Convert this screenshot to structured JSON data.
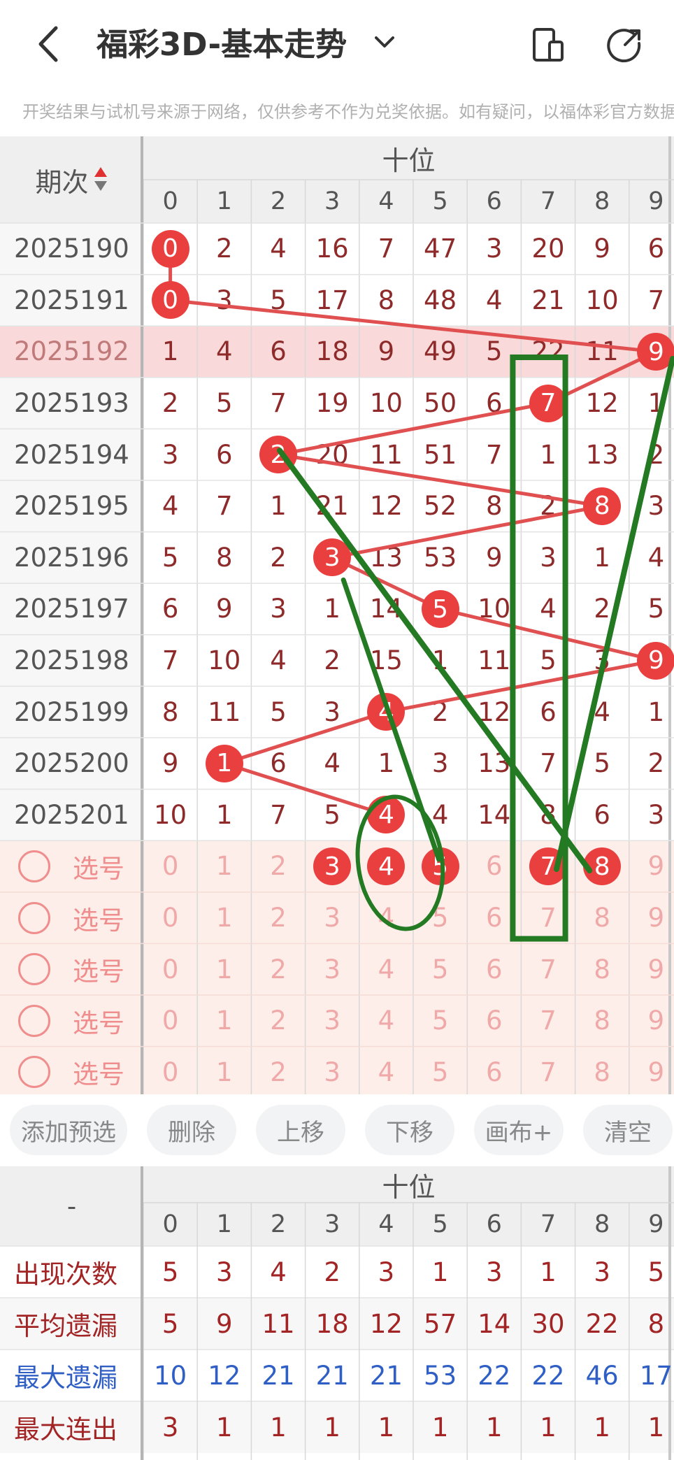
{
  "header": {
    "title": "福彩3D-基本走势",
    "notice": "开奖结果与试机号来源于网络，仅供参考不作为兑奖依据。如有疑问，以福体彩官方数据"
  },
  "table": {
    "period_header": "期次",
    "group_header": "十位",
    "digits": [
      "0",
      "1",
      "2",
      "3",
      "4",
      "5",
      "6",
      "7",
      "8",
      "9"
    ],
    "rows": [
      {
        "period": "2025190",
        "cells": [
          "0",
          "2",
          "4",
          "16",
          "7",
          "47",
          "3",
          "20",
          "9",
          "6"
        ],
        "hit": 0
      },
      {
        "period": "2025191",
        "cells": [
          "0",
          "3",
          "5",
          "17",
          "8",
          "48",
          "4",
          "21",
          "10",
          "7"
        ],
        "hit": 0
      },
      {
        "period": "2025192",
        "cells": [
          "1",
          "4",
          "6",
          "18",
          "9",
          "49",
          "5",
          "22",
          "11",
          "9"
        ],
        "hit": 9
      },
      {
        "period": "2025193",
        "cells": [
          "2",
          "5",
          "7",
          "19",
          "10",
          "50",
          "6",
          "7",
          "12",
          "1"
        ],
        "hit": 7
      },
      {
        "period": "2025194",
        "cells": [
          "3",
          "6",
          "2",
          "20",
          "11",
          "51",
          "7",
          "1",
          "13",
          "2"
        ],
        "hit": 2
      },
      {
        "period": "2025195",
        "cells": [
          "4",
          "7",
          "1",
          "21",
          "12",
          "52",
          "8",
          "2",
          "8",
          "3"
        ],
        "hit": 8
      },
      {
        "period": "2025196",
        "cells": [
          "5",
          "8",
          "2",
          "3",
          "13",
          "53",
          "9",
          "3",
          "1",
          "4"
        ],
        "hit": 3
      },
      {
        "period": "2025197",
        "cells": [
          "6",
          "9",
          "3",
          "1",
          "14",
          "5",
          "10",
          "4",
          "2",
          "5"
        ],
        "hit": 5
      },
      {
        "period": "2025198",
        "cells": [
          "7",
          "10",
          "4",
          "2",
          "15",
          "1",
          "11",
          "5",
          "3",
          "9"
        ],
        "hit": 9
      },
      {
        "period": "2025199",
        "cells": [
          "8",
          "11",
          "5",
          "3",
          "4",
          "2",
          "12",
          "6",
          "4",
          "1"
        ],
        "hit": 4
      },
      {
        "period": "2025200",
        "cells": [
          "9",
          "1",
          "6",
          "4",
          "1",
          "3",
          "13",
          "7",
          "5",
          "2"
        ],
        "hit": 1
      },
      {
        "period": "2025201",
        "cells": [
          "10",
          "1",
          "7",
          "5",
          "4",
          "4",
          "14",
          "8",
          "6",
          "3"
        ],
        "hit": 4
      }
    ],
    "pick_label": "选号",
    "pick_rows": [
      {
        "selected": [
          3,
          4,
          5,
          7,
          8
        ]
      },
      {
        "selected": []
      },
      {
        "selected": []
      },
      {
        "selected": []
      },
      {
        "selected": []
      }
    ]
  },
  "toolbar": {
    "buttons": [
      "添加预选",
      "删除",
      "上移",
      "下移",
      "画布+",
      "清空"
    ]
  },
  "stats": {
    "corner": "-",
    "group_header": "十位",
    "rows": [
      {
        "label": "出现次数",
        "values": [
          "5",
          "3",
          "4",
          "2",
          "3",
          "1",
          "3",
          "1",
          "3",
          "5"
        ],
        "color": "#a32424"
      },
      {
        "label": "平均遗漏",
        "values": [
          "5",
          "9",
          "11",
          "18",
          "12",
          "57",
          "14",
          "30",
          "22",
          "8"
        ],
        "color": "#a32424"
      },
      {
        "label": "最大遗漏",
        "values": [
          "10",
          "12",
          "21",
          "21",
          "21",
          "53",
          "22",
          "22",
          "46",
          "17"
        ],
        "color": "#2f5fc4"
      },
      {
        "label": "最大连出",
        "values": [
          "3",
          "1",
          "1",
          "1",
          "1",
          "1",
          "1",
          "1",
          "1",
          "1"
        ],
        "color": "#a32424"
      }
    ]
  },
  "colors": {
    "ball": "#ea3f3f",
    "line": "#e05050",
    "annotation": "#237a23",
    "highlight_row": "#f9d9d9",
    "pick_bg": "#fdeeea"
  }
}
